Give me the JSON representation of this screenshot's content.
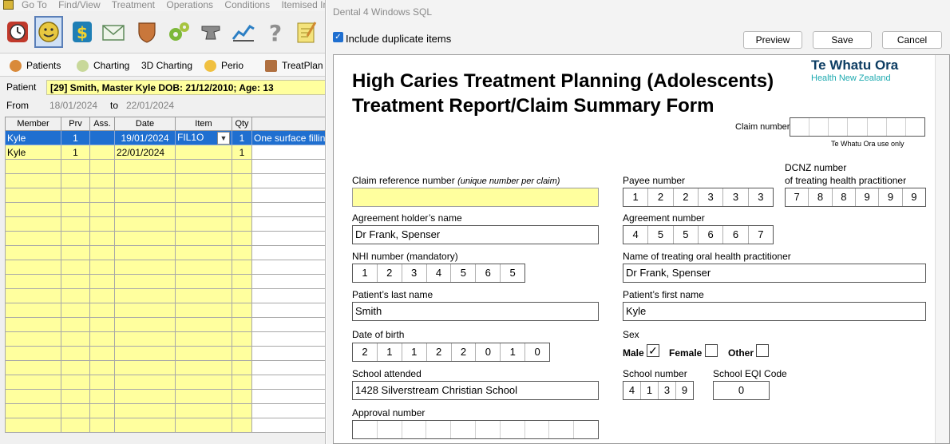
{
  "left": {
    "menu": [
      "Go To",
      "Find/View",
      "Treatment",
      "Operations",
      "Conditions",
      "Itemised In"
    ],
    "toolbar_icons": [
      "clock-icon",
      "smiley-icon",
      "dollar-icon",
      "envelope-icon",
      "shield-icon",
      "gears-icon",
      "anvil-icon",
      "chart-icon",
      "question-icon",
      "notepad-icon"
    ],
    "nav": [
      "Patients",
      "Charting",
      "3D Charting",
      "Perio",
      "TreatPlan"
    ],
    "patient_label": "Patient",
    "patient_value": "[29] Smith, Master Kyle DOB: 21/12/2010; Age: 13",
    "from_label": "From",
    "from_date": "18/01/2024",
    "to_label": "to",
    "to_date": "22/01/2024",
    "grid": {
      "headers": [
        "Member",
        "Prv",
        "Ass.",
        "Date",
        "Item",
        "Qty",
        ""
      ],
      "rows": [
        {
          "member": "Kyle",
          "prv": "1",
          "ass": "",
          "date": "19/01/2024",
          "item": "FIL1O",
          "qty": "1",
          "desc": "One surface filling"
        },
        {
          "member": "Kyle",
          "prv": "1",
          "ass": "",
          "date": "22/01/2024",
          "item": "",
          "qty": "1",
          "desc": ""
        }
      ]
    }
  },
  "right": {
    "window_title": "Dental 4 Windows SQL",
    "include_duplicates": "Include duplicate items",
    "preview": "Preview",
    "save": "Save",
    "cancel": "Cancel",
    "form": {
      "title_line1": "High Caries Treatment Planning (Adolescents)",
      "title_line2": "Treatment Report/Claim Summary Form",
      "logo_main": "Te Whatu Ora",
      "logo_sub": "Health New Zealand",
      "claim_number_label": "Claim number",
      "claim_number_note": "Te Whatu Ora  use only",
      "claim_ref_label": "Claim reference number",
      "claim_ref_note": "(unique number per claim)",
      "claim_ref_value": "",
      "payee_label": "Payee number",
      "payee_digits": [
        "1",
        "2",
        "2",
        "3",
        "3",
        "3"
      ],
      "dcnz_label1": "DCNZ number",
      "dcnz_label2": "of treating health practitioner",
      "dcnz_digits": [
        "7",
        "8",
        "8",
        "9",
        "9",
        "9"
      ],
      "agreement_holder_label": "Agreement holder’s name",
      "agreement_holder_value": "Dr Frank, Spenser",
      "agreement_number_label": "Agreement number",
      "agreement_digits": [
        "4",
        "5",
        "5",
        "6",
        "6",
        "7"
      ],
      "nhi_label": "NHI number (mandatory)",
      "nhi_digits": [
        "1",
        "2",
        "3",
        "4",
        "5",
        "6",
        "5"
      ],
      "practitioner_label": "Name of treating oral health practitioner",
      "practitioner_value": "Dr Frank, Spenser",
      "last_name_label": "Patient’s last name",
      "last_name_value": "Smith",
      "first_name_label": "Patient’s first name",
      "first_name_value": "Kyle",
      "dob_label": "Date of birth",
      "dob_digits": [
        "2",
        "1",
        "1",
        "2",
        "2",
        "0",
        "1",
        "0"
      ],
      "sex_label": "Sex",
      "male_label": "Male",
      "female_label": "Female",
      "other_label": "Other",
      "male_check": "✓",
      "school_label": "School attended",
      "school_value": "1428 Silverstream Christian School",
      "school_number_label": "School number",
      "school_number_digits": [
        "4",
        "1",
        "3",
        "9"
      ],
      "school_eqi_label": "School EQI Code",
      "school_eqi_value": "0",
      "approval_label": "Approval number"
    }
  }
}
